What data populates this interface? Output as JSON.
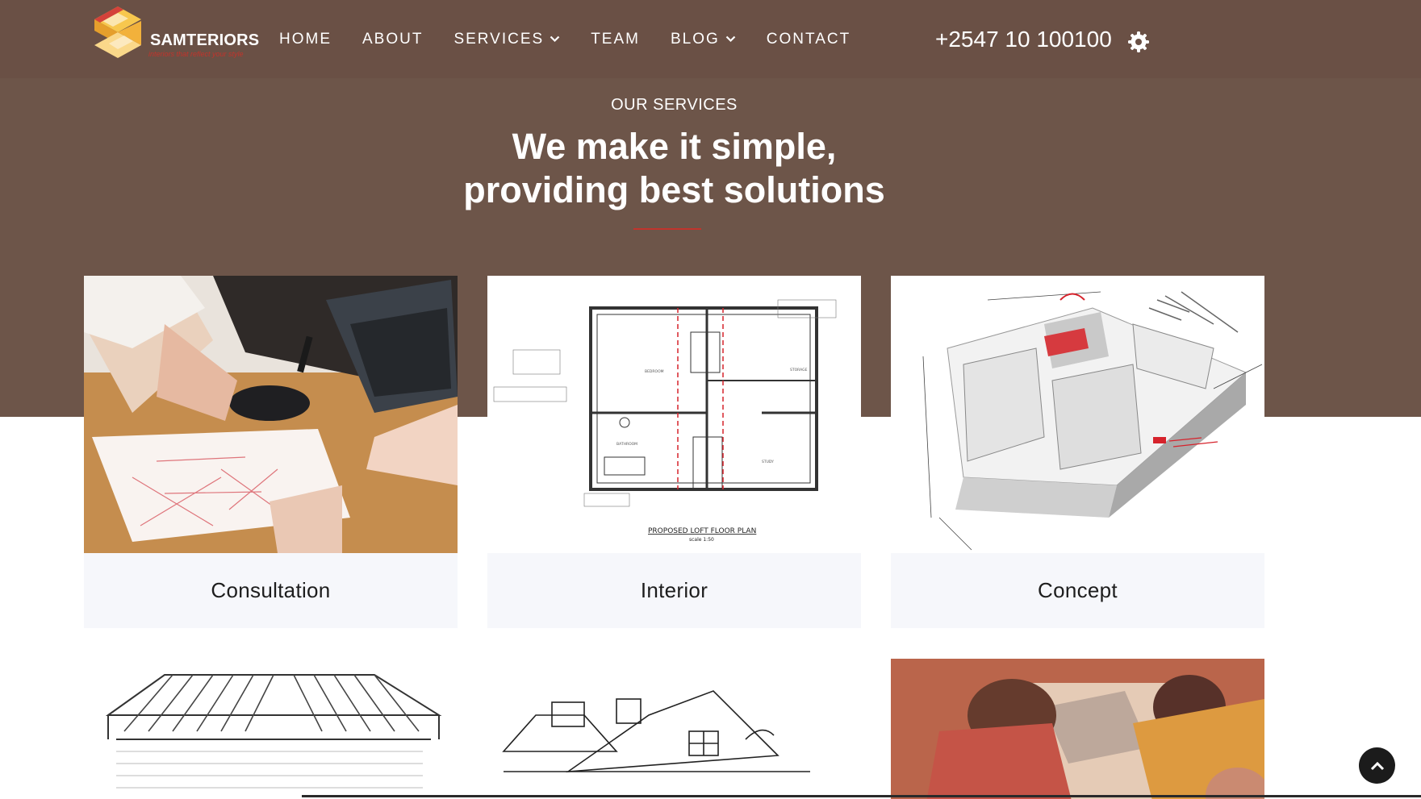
{
  "brand": {
    "name": "SAMTERIORS",
    "tagline": "interiors that reflect your style"
  },
  "nav": {
    "items": [
      {
        "label": "HOME",
        "has_dropdown": false
      },
      {
        "label": "ABOUT",
        "has_dropdown": false
      },
      {
        "label": "SERVICES",
        "has_dropdown": true
      },
      {
        "label": "TEAM",
        "has_dropdown": false
      },
      {
        "label": "BLOG",
        "has_dropdown": true
      },
      {
        "label": "CONTACT",
        "has_dropdown": false
      }
    ],
    "phone": "+2547 10 100100",
    "settings_icon": "gear-icon"
  },
  "services": {
    "eyebrow": "OUR SERVICES",
    "title_line1": "We make it simple,",
    "title_line2": "providing best solutions",
    "cards": [
      {
        "label": "Consultation"
      },
      {
        "label": "Interior"
      },
      {
        "label": "Concept"
      }
    ],
    "floorplan_caption": "PROPOSED LOFT FLOOR PLAN",
    "floorplan_scale": "scale 1:50"
  },
  "scroll_top_icon": "chevron-up-icon",
  "colors": {
    "header_bg": "#6a5045",
    "band_bg": "#6d5549",
    "accent": "#c2342c",
    "card_label_bg": "#f6f7fb"
  }
}
